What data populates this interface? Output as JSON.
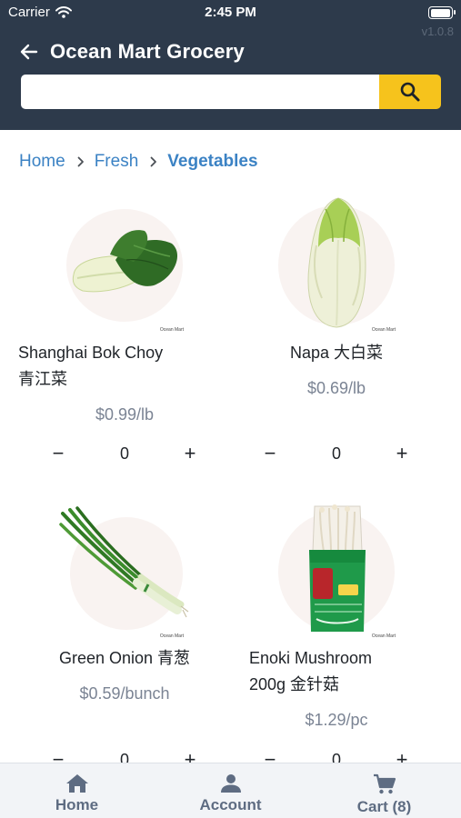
{
  "status_bar": {
    "carrier": "Carrier",
    "time": "2:45 PM",
    "battery_level": 1.0
  },
  "app": {
    "version": "v1.0.8",
    "title": "Ocean Mart Grocery"
  },
  "search": {
    "value": "",
    "placeholder": ""
  },
  "breadcrumb": {
    "items": [
      "Home",
      "Fresh"
    ],
    "current": "Vegetables"
  },
  "products": [
    {
      "name": "Shanghai Bok Choy\n青江菜",
      "price": "$0.99/lb",
      "quantity": "0",
      "watermark": "Ocean Mart"
    },
    {
      "name": "Napa 大白菜",
      "price": "$0.69/lb",
      "quantity": "0",
      "watermark": "Ocean Mart"
    },
    {
      "name": "Green Onion 青葱",
      "price": "$0.59/bunch",
      "quantity": "0",
      "watermark": "Ocean Mart"
    },
    {
      "name": "Enoki Mushroom\n200g 金针菇",
      "price": "$1.29/pc",
      "quantity": "0",
      "watermark": "Ocean Mart"
    }
  ],
  "qty_controls": {
    "minus": "−",
    "plus": "+"
  },
  "tabbar": {
    "home": "Home",
    "account": "Account",
    "cart": "Cart (8)"
  },
  "colors": {
    "header_bg": "#2d3a4b",
    "search_button": "#f6c31c",
    "link": "#3b82c4",
    "price": "#7b8494",
    "tab_label": "#5e6c82"
  },
  "icons": {
    "back": "arrow-left-icon",
    "search": "magnifier-icon",
    "home": "house-icon",
    "account": "person-icon",
    "cart": "cart-icon",
    "wifi": "wifi-icon"
  }
}
